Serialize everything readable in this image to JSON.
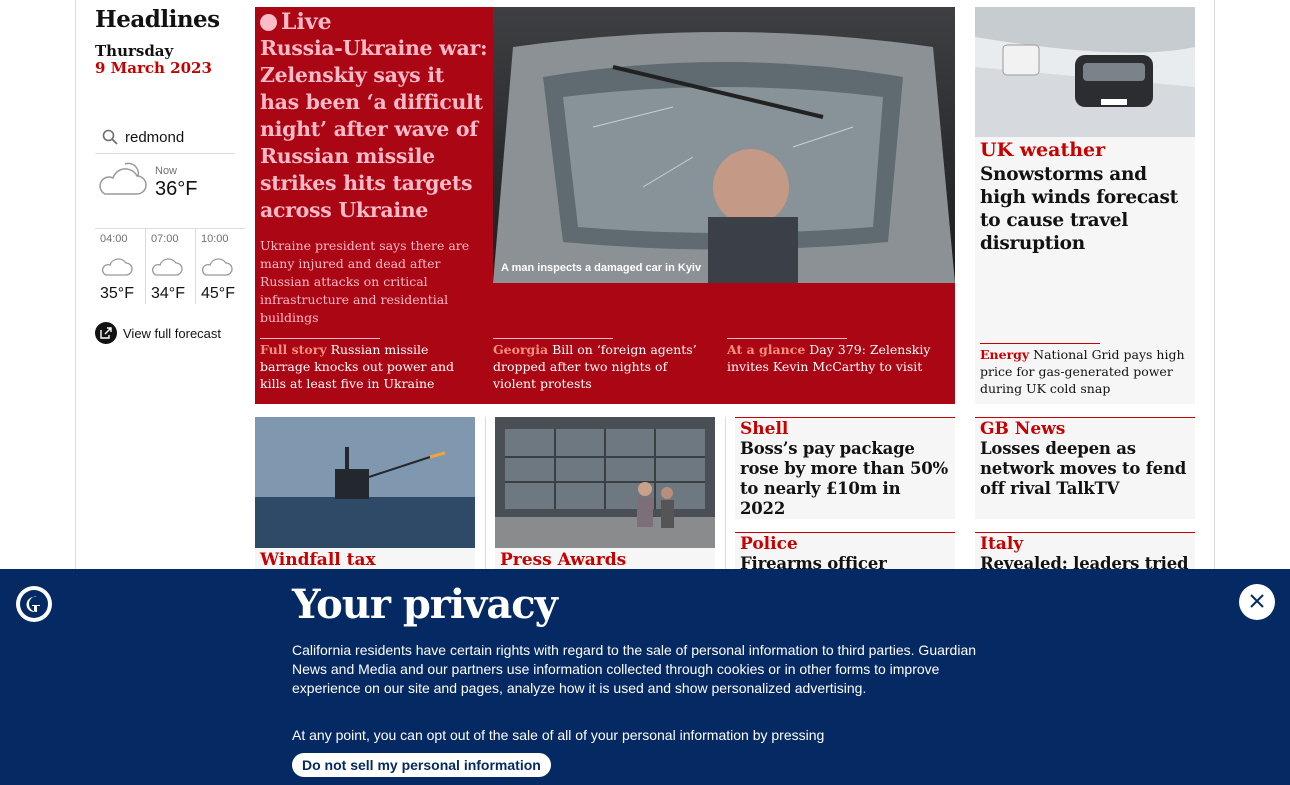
{
  "sidebar": {
    "section_title": "Headlines",
    "day": "Thursday",
    "date": "9 March 2023",
    "search": {
      "value": "redmond"
    },
    "weather": {
      "now_label": "Now",
      "now_temp": "36°F",
      "now_icon": "partly-cloudy-icon",
      "forecast": [
        {
          "time": "04:00",
          "temp": "35°F",
          "icon": "cloud-icon"
        },
        {
          "time": "07:00",
          "temp": "34°F",
          "icon": "cloud-icon"
        },
        {
          "time": "10:00",
          "temp": "45°F",
          "icon": "cloud-icon"
        }
      ],
      "view_full_forecast": "View full forecast"
    }
  },
  "live": {
    "kicker": "Live",
    "headline": "Russia-Ukraine war: Zelenskiy says it has been ‘a difficult night’ after wave of Russian missile strikes hits targets across Ukraine",
    "standfirst": "Ukraine president says there are many injured and dead after Russian attacks on critical infrastructure and residential buildings",
    "photo_caption": "A man inspects a damaged car in Kyiv",
    "sublinks": [
      {
        "kicker": "Full story",
        "text": "Russian missile barrage knocks out power and kills at least five in Ukraine"
      },
      {
        "kicker": "Georgia",
        "text": "Bill on ‘foreign agents’ dropped after two nights of violent protests"
      },
      {
        "kicker": "At a glance",
        "text": "Day 379: Zelenskiy invites Kevin McCarthy to visit"
      }
    ]
  },
  "weather_story": {
    "kicker": "UK weather",
    "headline": "Snowstorms and high winds forecast to cause travel disruption",
    "sublink": {
      "kicker": "Energy",
      "text": "National Grid pays high price for gas-generated power during UK cold snap"
    }
  },
  "cards": [
    {
      "kicker": "Windfall tax",
      "headline": ""
    },
    {
      "kicker": "Press Awards",
      "headline": ""
    },
    {
      "kicker": "Shell",
      "headline": "Boss’s pay package rose by more than 50% to nearly £10m in 2022"
    },
    {
      "kicker": "GB News",
      "headline": "Losses deepen as network moves to fend off rival TalkTV"
    },
    {
      "kicker": "Police",
      "headline": "Firearms officer ‘secretly"
    },
    {
      "kicker": "Italy",
      "headline": "Revealed: leaders tried to"
    }
  ],
  "privacy": {
    "title": "Your privacy",
    "body": "California residents have certain rights with regard to the sale of personal information to third parties. Guardian News and Media and our partners use information collected through cookies or in other forms to improve experience on our site and pages, analyze how it is used and show personalized advertising.",
    "body2": "At any point, you can opt out of the sale of all of your personal information by pressing",
    "button": "Do not sell my personal information"
  },
  "colors": {
    "live_bg": "#ab0613",
    "live_text": "#ffbac8",
    "news_red": "#c70000",
    "banner_bg": "#052962"
  }
}
